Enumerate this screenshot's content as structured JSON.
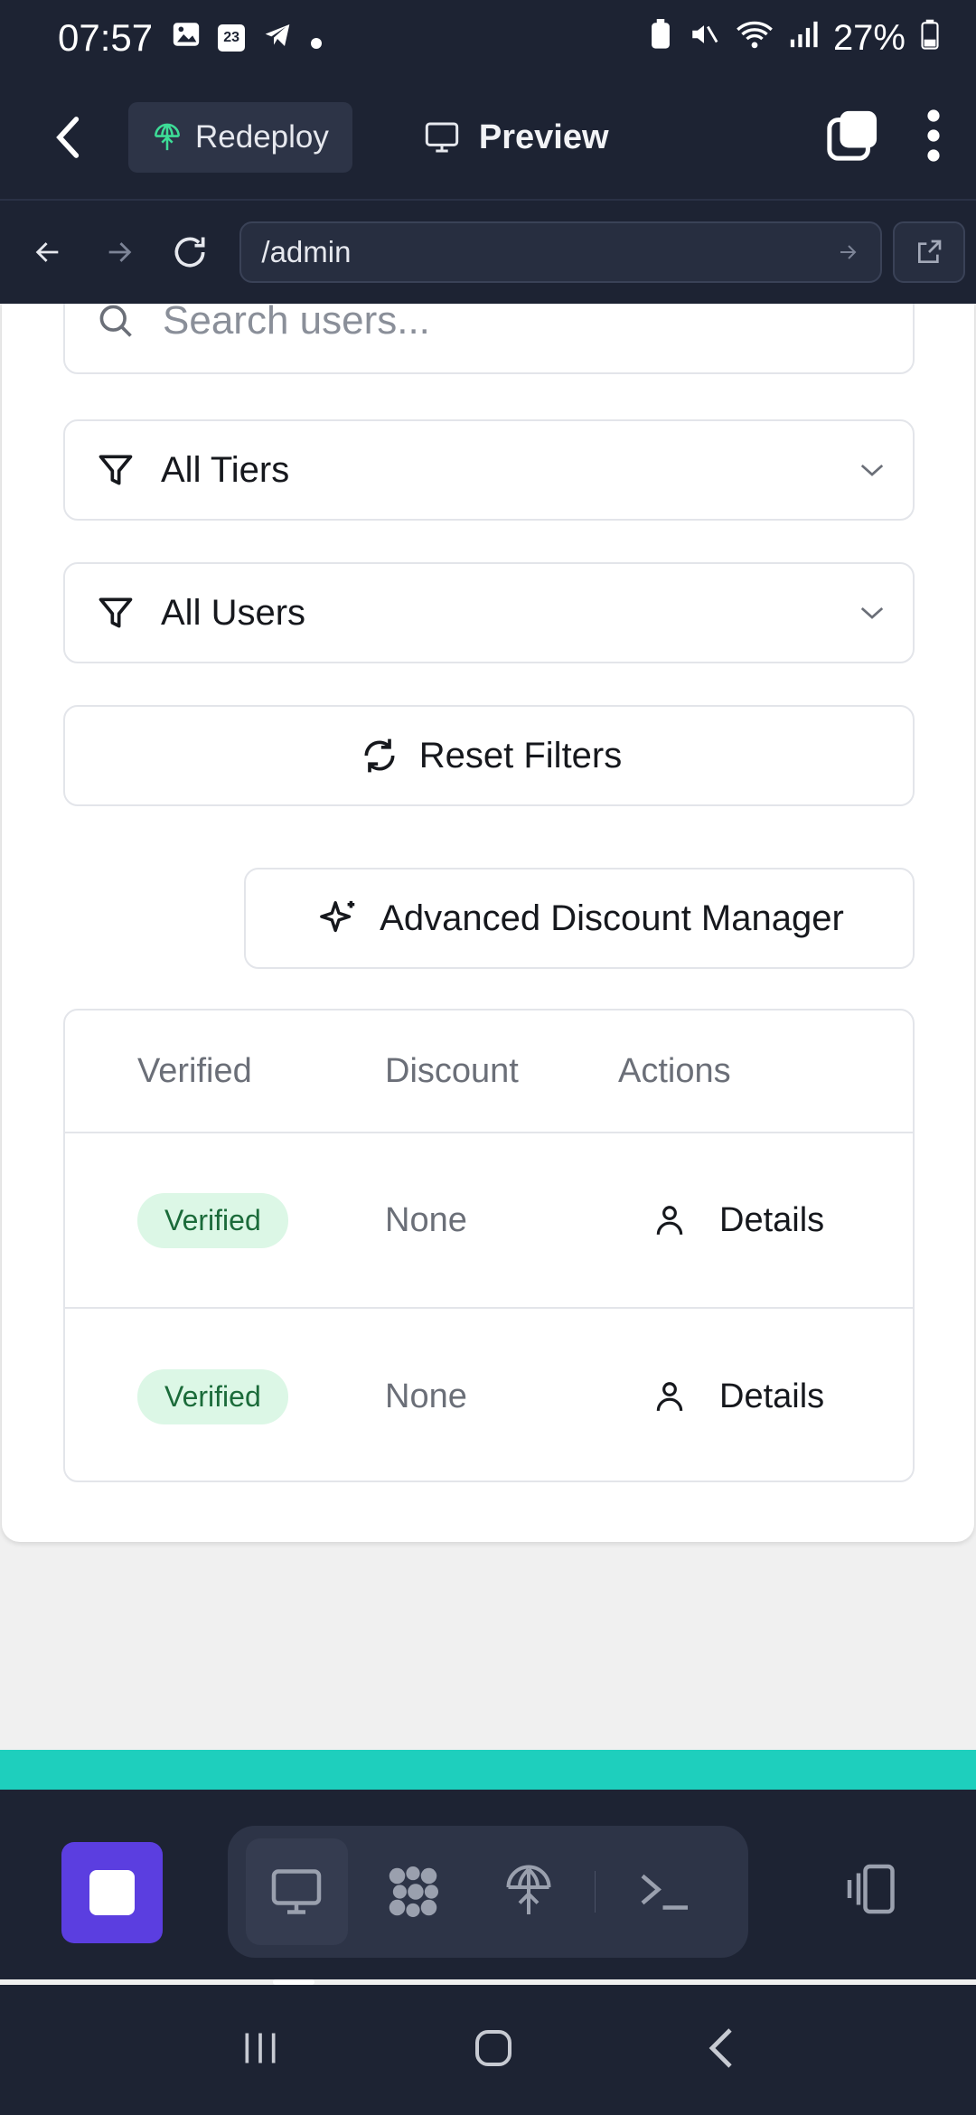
{
  "status_bar": {
    "time": "07:57",
    "calendar_day": "23",
    "battery": "27%"
  },
  "header": {
    "redeploy_label": "Redeploy",
    "preview_label": "Preview"
  },
  "url_bar": {
    "url": "/admin"
  },
  "filters": {
    "search_placeholder": "Search users...",
    "tier_select": "All Tiers",
    "user_select": "All Users",
    "reset_label": "Reset Filters",
    "advanced_label": "Advanced Discount Manager"
  },
  "table": {
    "headers": [
      "Verified",
      "Discount",
      "Actions"
    ],
    "rows": [
      {
        "verified": "Verified",
        "discount": "None",
        "action": "Details"
      },
      {
        "verified": "Verified",
        "discount": "None",
        "action": "Details"
      }
    ]
  },
  "colors": {
    "header_bg": "#1d2333",
    "accent": "#5b3ee0",
    "teal": "#1ecfbd",
    "badge_bg": "#dcf7e6",
    "badge_text": "#1b6b3a"
  }
}
